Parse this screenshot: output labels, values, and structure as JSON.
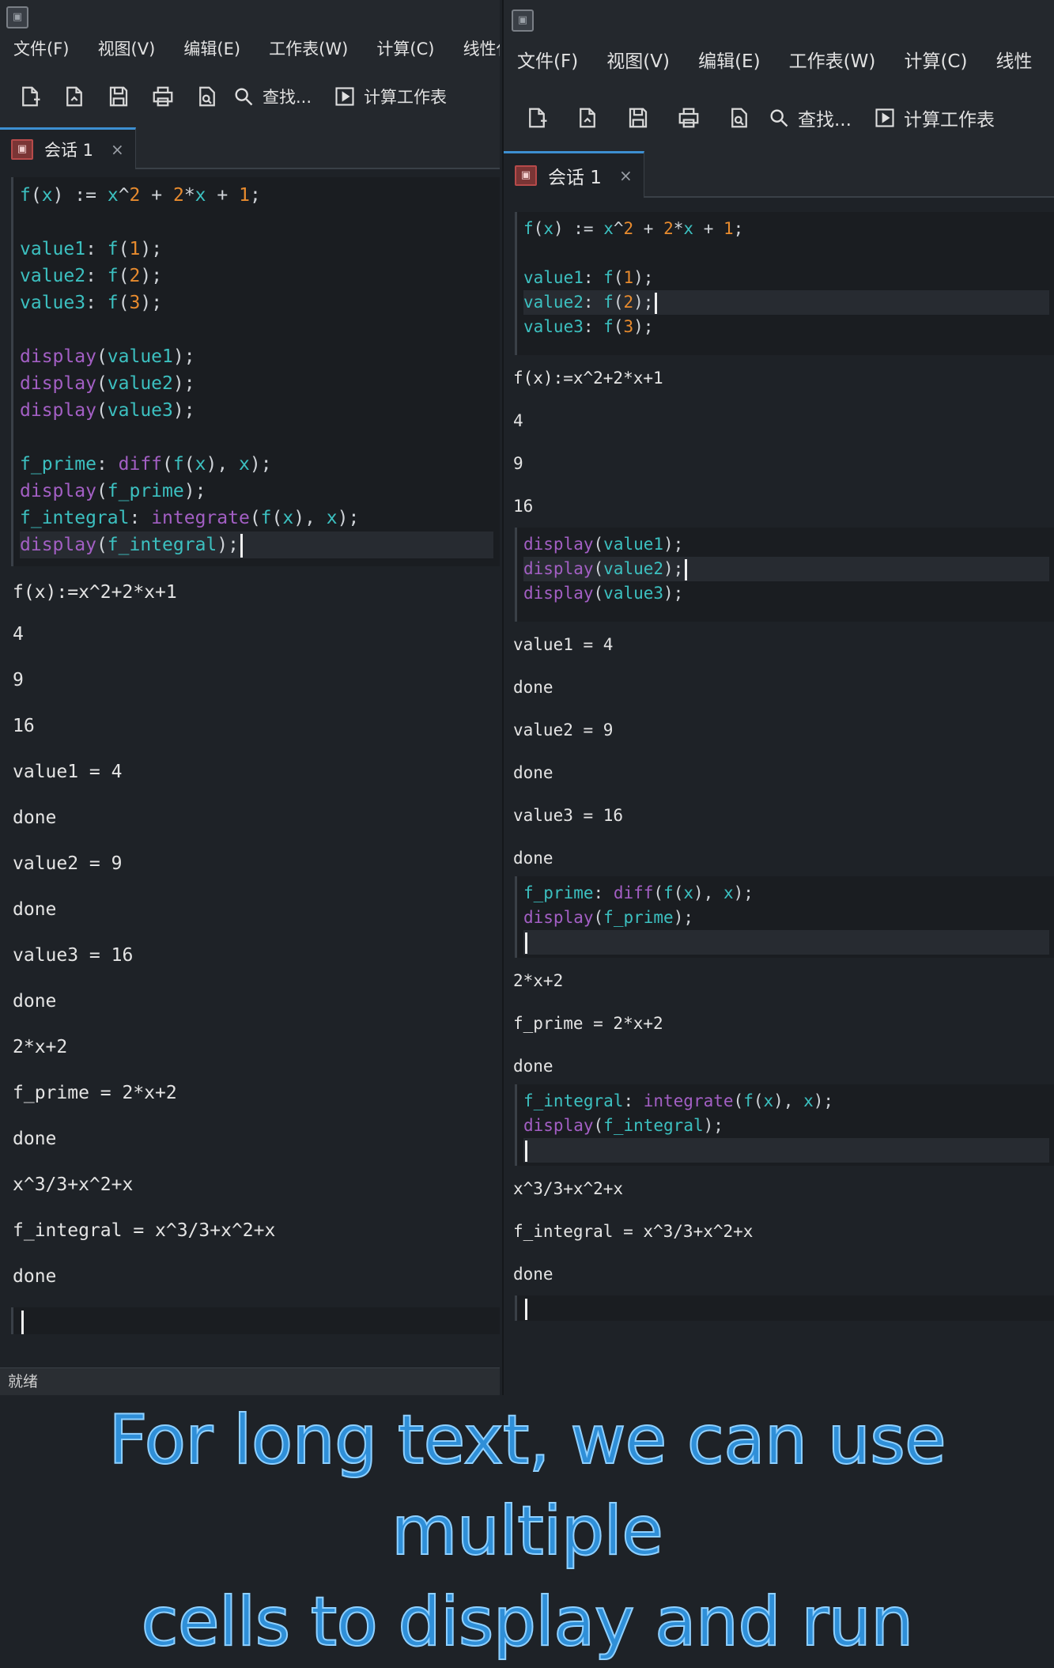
{
  "left": {
    "app_icon": "app-icon",
    "menu": [
      "文件(F)",
      "视图(V)",
      "编辑(E)",
      "工作表(W)",
      "计算(C)",
      "线性代"
    ],
    "toolbar": {
      "find_label": "查找...",
      "compute_label": "计算工作表"
    },
    "tab": {
      "label": "会话 1",
      "close": "×"
    },
    "outputs": [
      "f(x):=x^2+2*x+1",
      "4",
      "9",
      "16",
      "value1 = 4",
      "done",
      "value2 = 9",
      "done",
      "value3 = 16",
      "done",
      "2*x+2",
      "f_prime = 2*x+2",
      "done",
      "x^3/3+x^2+x",
      "f_integral = x^3/3+x^2+x",
      "done"
    ],
    "status": "就绪"
  },
  "right": {
    "menu": [
      "文件(F)",
      "视图(V)",
      "编辑(E)",
      "工作表(W)",
      "计算(C)",
      "线性"
    ],
    "toolbar": {
      "find_label": "查找...",
      "compute_label": "计算工作表"
    },
    "tab": {
      "label": "会话 1",
      "close": "×"
    },
    "outputs1": [
      "f(x):=x^2+2*x+1",
      "4",
      "9",
      "16"
    ],
    "outputs2": [
      "value1 = 4",
      "done",
      "value2 = 9",
      "done",
      "value3 = 16",
      "done"
    ],
    "outputs3": [
      "2*x+2",
      "f_prime = 2*x+2",
      "done"
    ],
    "outputs4": [
      "x^3/3+x^2+x",
      "f_integral = x^3/3+x^2+x",
      "done"
    ]
  },
  "caption": {
    "line1": "For long text, we can use multiple",
    "line2": "cells to display and run"
  },
  "colors": {
    "accent": "#3d8fd1",
    "variable": "#3cc0c0",
    "function": "#a35fc4",
    "number": "#e88b2e",
    "caption": "#2f8fd8"
  }
}
